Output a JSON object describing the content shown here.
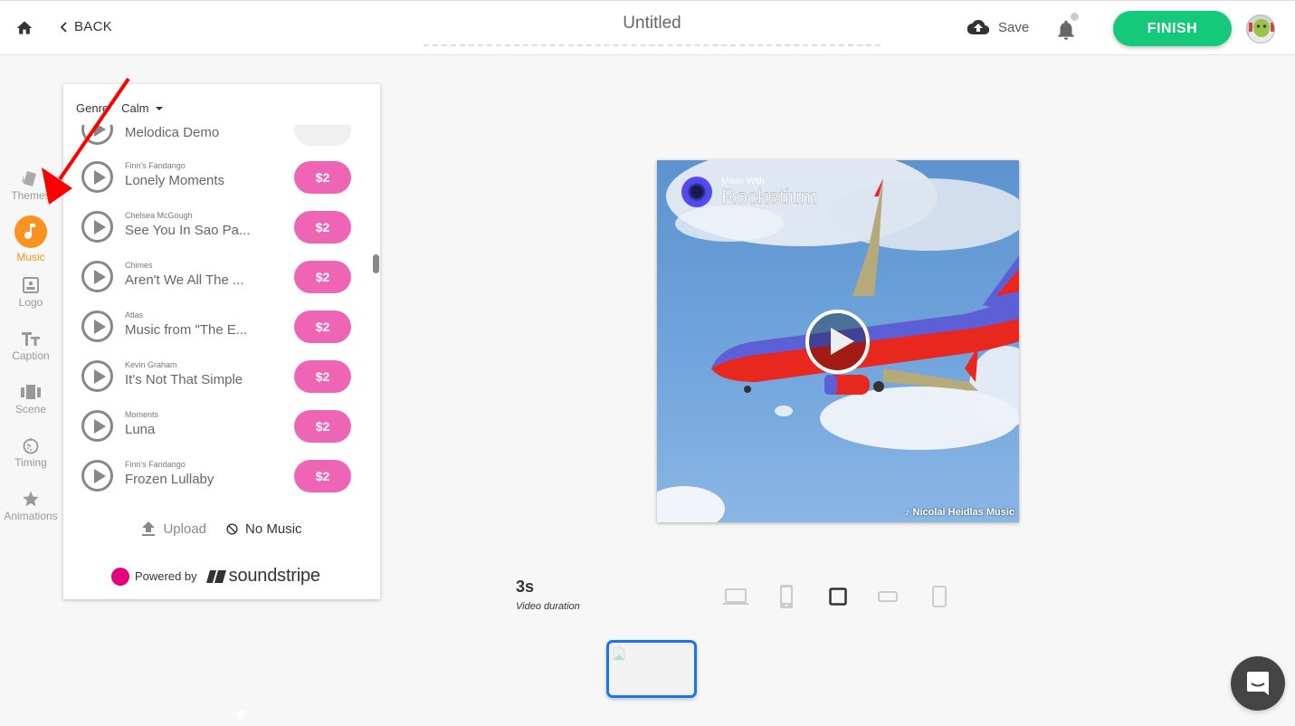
{
  "header": {
    "back_label": "BACK",
    "title": "Untitled",
    "save_label": "Save",
    "finish_label": "FINISH",
    "notification_dot": true
  },
  "sidebar": {
    "items": [
      {
        "id": "themes",
        "label": "Themes",
        "icon": "themes-icon",
        "active": false
      },
      {
        "id": "music",
        "label": "Music",
        "icon": "music-note-icon",
        "active": true
      },
      {
        "id": "logo",
        "label": "Logo",
        "icon": "logo-icon",
        "active": false
      },
      {
        "id": "caption",
        "label": "Caption",
        "icon": "text-icon",
        "active": false
      },
      {
        "id": "scene",
        "label": "Scene",
        "icon": "scene-icon",
        "active": false
      },
      {
        "id": "timing",
        "label": "Timing",
        "icon": "timer-icon",
        "active": false
      },
      {
        "id": "animations",
        "label": "Animations",
        "icon": "star-icon",
        "active": false
      }
    ],
    "accent_color": "#f7931e"
  },
  "music_panel": {
    "genre_label": "Genre",
    "genre_value": "Calm",
    "tracks": [
      {
        "artist": "",
        "title": "Melodica Demo",
        "price": "",
        "partial": true
      },
      {
        "artist": "Finn's Fandango",
        "title": "Lonely Moments",
        "price": "$2"
      },
      {
        "artist": "Chelsea McGough",
        "title": "See You In Sao Pa...",
        "price": "$2"
      },
      {
        "artist": "Chimes",
        "title": "Aren't We All The ...",
        "price": "$2"
      },
      {
        "artist": "Atlas",
        "title": "Music from \"The E...",
        "price": "$2"
      },
      {
        "artist": "Kevin Graham",
        "title": "It's Not That Simple",
        "price": "$2"
      },
      {
        "artist": "Moments",
        "title": "Luna",
        "price": "$2"
      },
      {
        "artist": "Finn's Fandango",
        "title": "Frozen Lullaby",
        "price": "$2"
      }
    ],
    "upload_label": "Upload",
    "no_music_label": "No Music",
    "powered_by_label": "Powered by",
    "brand_name": "soundstripe",
    "price_color": "#ef65b5"
  },
  "preview": {
    "watermark_small": "Made With",
    "watermark_large": "Rocketium",
    "music_credit": "Nicolai Heidlas Music"
  },
  "bottom": {
    "duration_value": "3s",
    "duration_label": "Video duration",
    "formats": [
      {
        "id": "landscape-desktop",
        "icon": "laptop-icon",
        "selected": false
      },
      {
        "id": "portrait-mobile",
        "icon": "phone-icon",
        "selected": false
      },
      {
        "id": "square",
        "icon": "square-icon",
        "selected": true
      },
      {
        "id": "wide-banner",
        "icon": "wide-rect-icon",
        "selected": false
      },
      {
        "id": "vertical",
        "icon": "tall-rect-icon",
        "selected": false
      }
    ]
  }
}
